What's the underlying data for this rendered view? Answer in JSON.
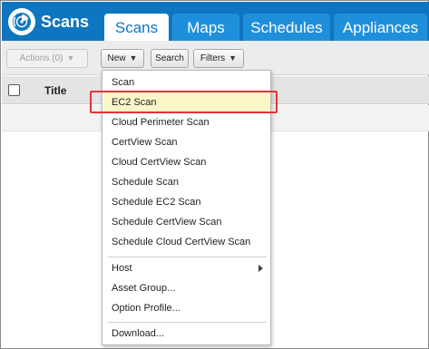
{
  "app": {
    "title": "Scans"
  },
  "tabs": [
    {
      "label": "Scans",
      "active": true
    },
    {
      "label": "Maps",
      "active": false
    },
    {
      "label": "Schedules",
      "active": false
    },
    {
      "label": "Appliances",
      "active": false
    }
  ],
  "toolbar": {
    "actions_label": "Actions (0)",
    "new_label": "New",
    "search_label": "Search",
    "filters_label": "Filters"
  },
  "table": {
    "columns": [
      "Title"
    ]
  },
  "menu": {
    "items": [
      "Scan",
      "EC2 Scan",
      "Cloud Perimeter Scan",
      "CertView Scan",
      "Cloud CertView Scan",
      "Schedule Scan",
      "Schedule EC2 Scan",
      "Schedule CertView Scan",
      "Schedule Cloud CertView Scan"
    ],
    "host_label": "Host",
    "asset_group_label": "Asset Group...",
    "option_profile_label": "Option Profile...",
    "download_label": "Download...",
    "highlighted_item": "EC2 Scan"
  },
  "colors": {
    "header_blue": "#0e76c0",
    "tab_blue": "#1f8fdc",
    "highlight_border": "#e5333a",
    "highlight_fill": "#fbf6c8"
  },
  "icons": {
    "brand": "scans-radar-logo-icon",
    "caret": "chevron-down-icon",
    "submenu": "chevron-right-icon"
  }
}
